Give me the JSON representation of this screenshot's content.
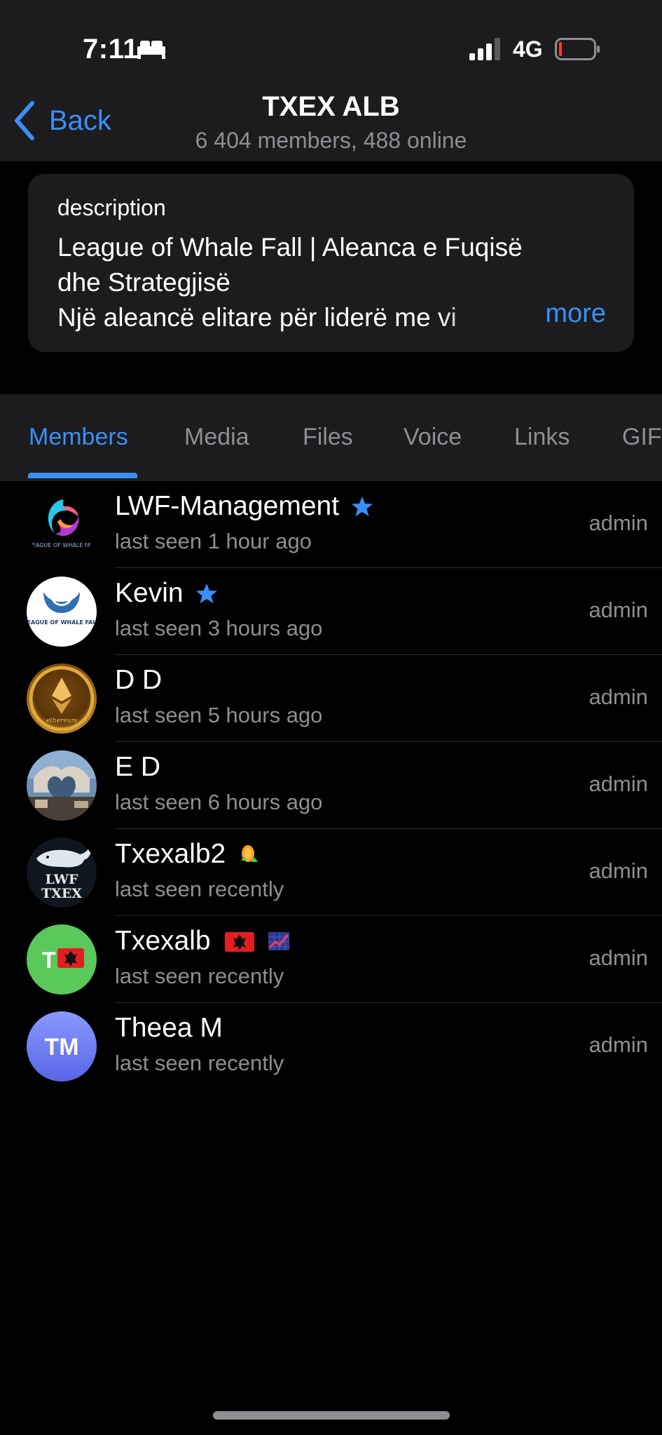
{
  "status_bar": {
    "time": "7:11",
    "network": "4G",
    "icons": [
      "bed-icon",
      "signal-icon",
      "battery-icon"
    ],
    "battery_color": "#ff3b30"
  },
  "nav": {
    "back_label": "Back",
    "title": "TXEX ALB",
    "subtitle": "6 404 members, 488 online"
  },
  "description": {
    "label": "description",
    "lines": [
      "League of Whale Fall | Aleanca e Fuqisë",
      "dhe Strategjisë",
      "Një aleancë elitare për liderë me vi"
    ],
    "more_label": "more"
  },
  "tabs": [
    {
      "label": "Members",
      "active": true
    },
    {
      "label": "Media",
      "active": false
    },
    {
      "label": "Files",
      "active": false
    },
    {
      "label": "Voice",
      "active": false
    },
    {
      "label": "Links",
      "active": false
    },
    {
      "label": "GIF",
      "active": false
    }
  ],
  "members": [
    {
      "name": "LWF-Management",
      "status": "last seen 1 hour ago",
      "role": "admin",
      "avatar_icon": "lwf-logo-avatar",
      "badge": "star-icon"
    },
    {
      "name": "Kevin",
      "status": "last seen 3 hours ago",
      "role": "admin",
      "avatar_icon": "whale-logo-avatar",
      "badge": "star-icon"
    },
    {
      "name": "D D",
      "status": "last seen 5 hours ago",
      "role": "admin",
      "avatar_icon": "ethereum-coin-avatar",
      "badge": ""
    },
    {
      "name": "E D",
      "status": "last seen 6 hours ago",
      "role": "admin",
      "avatar_icon": "photo-avatar",
      "badge": ""
    },
    {
      "name": "Txexalb2",
      "status": "last seen recently",
      "role": "admin",
      "avatar_icon": "lwf-txex-whale-avatar",
      "badge": "coin-up-icon"
    },
    {
      "name": "Txexalb",
      "status": "last seen recently",
      "role": "admin",
      "avatar_icon": "initials-avatar",
      "avatar_initials": "T",
      "badge": "albania-flag-icon",
      "badge2": "chart-up-icon"
    },
    {
      "name": "Theea M",
      "status": "last seen recently",
      "role": "admin",
      "avatar_icon": "initials-avatar",
      "avatar_initials": "TM",
      "badge": ""
    }
  ],
  "colors": {
    "accent": "#3a8ff7",
    "secondary_text": "#8e8e93",
    "panel": "#1c1c1e",
    "avatar_green": "#5ac85a",
    "avatar_purple": "#6e7df7"
  }
}
